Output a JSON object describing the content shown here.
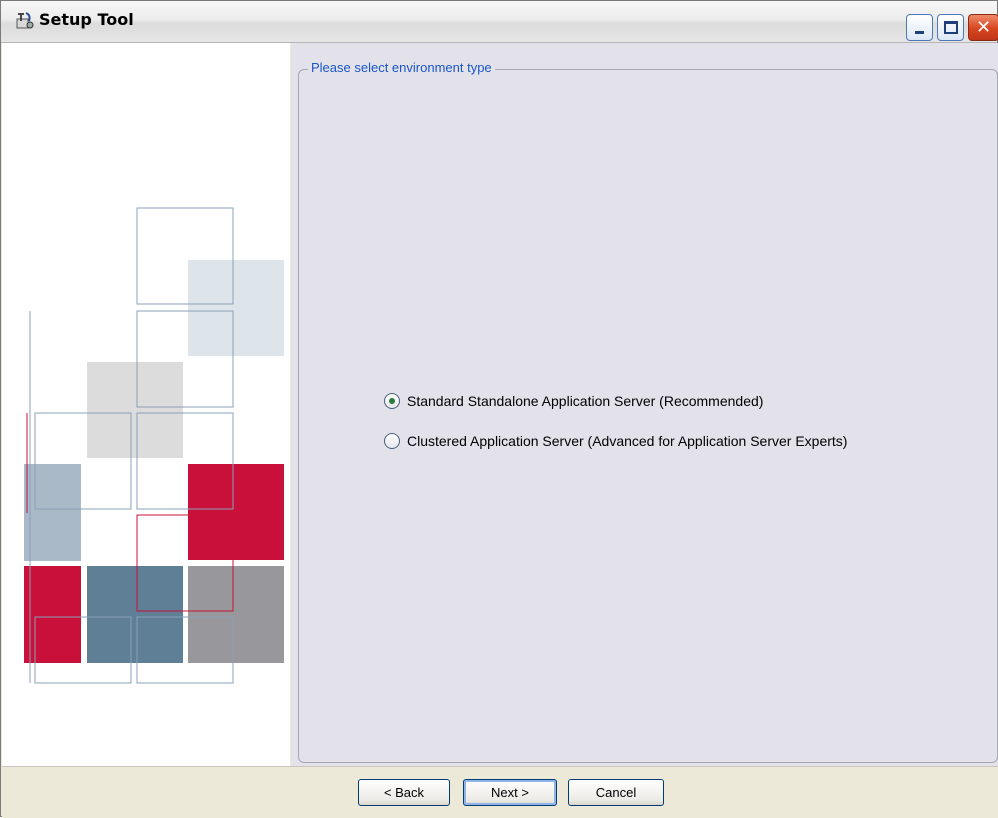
{
  "window": {
    "title": "Setup Tool",
    "icon": "setup-app-icon",
    "controls": [
      "minimize-icon",
      "maximize-icon",
      "close-icon"
    ]
  },
  "group": {
    "legend": "Please select environment type"
  },
  "options": [
    {
      "label": "Standard Standalone Application Server (Recommended)",
      "selected": true
    },
    {
      "label": "Clustered Application Server (Advanced for Application Server Experts)",
      "selected": false
    }
  ],
  "buttons": {
    "back": "< Back",
    "next": "Next >",
    "cancel": "Cancel"
  },
  "colors": {
    "legend_text": "#1a55c8",
    "content_bg": "#e3e2ea",
    "accent_red": "#c8103a",
    "steel_blue": "#5f7f97"
  }
}
